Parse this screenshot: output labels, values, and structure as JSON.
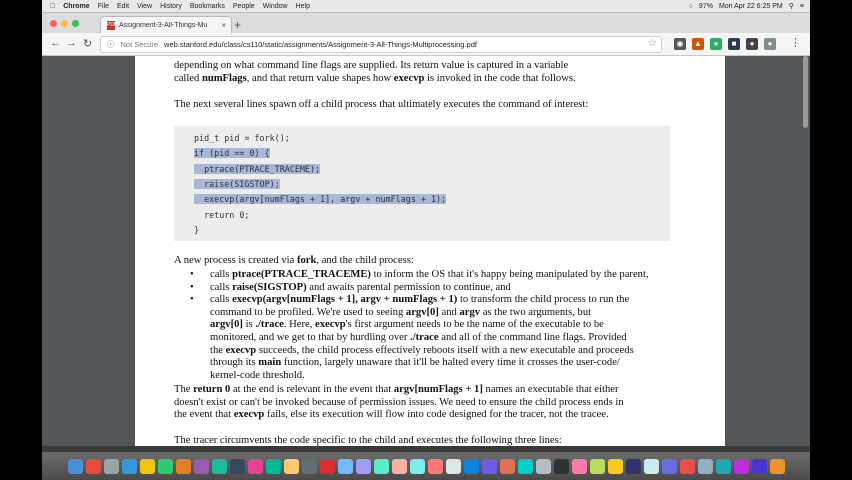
{
  "menubar": {
    "items": [
      "Chrome",
      "File",
      "Edit",
      "View",
      "History",
      "Bookmarks",
      "People",
      "Window",
      "Help"
    ],
    "battery": "97%",
    "datetime": "Mon Apr 22  6:25 PM"
  },
  "tab": {
    "title": "Assignment-3-All-Things-Mu",
    "favicon": "PDF"
  },
  "toolbar": {
    "security": "Not Secure",
    "url": "web.stanford.edu/class/cs110/static/assignments/Assignment-3-All-Things-Multiprocessing.pdf"
  },
  "doc": {
    "p1": [
      [
        {
          "t": "depending on what command line flags are supplied.  Its return value is captured in a variable"
        }
      ],
      [
        {
          "t": "called "
        },
        {
          "t": "numFlags",
          "b": true
        },
        {
          "t": ", and that return value shapes how "
        },
        {
          "t": "execvp",
          "b": true
        },
        {
          "t": " is invoked in the code that follows."
        }
      ]
    ],
    "p2": "The next several lines spawn off a child process that ultimately executes the command of interest:",
    "code": [
      "pid_t pid = fork();",
      "if (pid == 0) {",
      "  ptrace(PTRACE_TRACEME);",
      "  raise(SIGSTOP);",
      "  execvp(argv[numFlags + 1], argv + numFlags + 1);",
      "  return 0;",
      "}"
    ],
    "p3": [
      {
        "t": "A new process is created via "
      },
      {
        "t": "fork",
        "b": true
      },
      {
        "t": ", and the child process:"
      }
    ],
    "bullets": [
      [
        [
          {
            "t": "calls "
          },
          {
            "t": "ptrace(PTRACE_TRACEME)",
            "b": true
          },
          {
            "t": " to inform the OS that it's happy being manipulated by the parent,"
          }
        ]
      ],
      [
        [
          {
            "t": "calls "
          },
          {
            "t": "raise(SIGSTOP)",
            "b": true
          },
          {
            "t": " and awaits parental permission to continue, and"
          }
        ]
      ],
      [
        [
          {
            "t": "calls "
          },
          {
            "t": "execvp(argv[numFlags + 1], argv + numFlags + 1)",
            "b": true
          },
          {
            "t": " to transform the child process to run the"
          }
        ],
        [
          {
            "t": "command to be profiled.  We're used to seeing "
          },
          {
            "t": "argv[0]",
            "b": true
          },
          {
            "t": " and "
          },
          {
            "t": "argv",
            "b": true
          },
          {
            "t": " as the two arguments, but"
          }
        ],
        [
          {
            "t": "argv[0]",
            "b": true
          },
          {
            "t": " is "
          },
          {
            "t": "./trace",
            "b": true
          },
          {
            "t": ".  Here, "
          },
          {
            "t": "execvp",
            "b": true
          },
          {
            "t": "'s first argument needs to be the name of the executable to be"
          }
        ],
        [
          {
            "t": "monitored, and we get to that by hurdling over  "
          },
          {
            "t": "./trace",
            "b": true
          },
          {
            "t": " and all of the command line flags.  Provided"
          }
        ],
        [
          {
            "t": "the "
          },
          {
            "t": "execvp",
            "b": true
          },
          {
            "t": " succeeds, the child process effectively reboots itself with a new executable and proceeds"
          }
        ],
        [
          {
            "t": "through its "
          },
          {
            "t": "main",
            "b": true
          },
          {
            "t": " function, largely unaware that it'll be halted every time it crosses the user-code/"
          }
        ],
        [
          {
            "t": "kernel-code threshold."
          }
        ]
      ]
    ],
    "p4": [
      [
        {
          "t": "The "
        },
        {
          "t": "return 0",
          "b": true
        },
        {
          "t": " at the end is relevant in the event that "
        },
        {
          "t": "argv[numFlags + 1]",
          "b": true
        },
        {
          "t": " names an executable that either"
        }
      ],
      [
        {
          "t": "doesn't exist or can't be invoked because of permission issues.  We need to ensure the child process ends in"
        }
      ],
      [
        {
          "t": "the event that "
        },
        {
          "t": "execvp",
          "b": true
        },
        {
          "t": " fails, else its execution will flow into code designed for the tracer, not the tracee."
        }
      ]
    ],
    "p5": "The tracer circumvents the code specific to the child and executes the following three lines:"
  },
  "colors": {
    "selection": "#a8b7d6",
    "code_bg": "#ededed",
    "viewer_bg": "#525659"
  },
  "dock_icons": [
    "#4a90d9",
    "#e74c3c",
    "#95a5a6",
    "#3498db",
    "#f1c40f",
    "#2ecc71",
    "#e67e22",
    "#9b59b6",
    "#1abc9c",
    "#34495e",
    "#e84393",
    "#00b894",
    "#fdcb6e",
    "#636e72",
    "#d63031",
    "#74b9ff",
    "#a29bfe",
    "#55efc4",
    "#fab1a0",
    "#81ecec",
    "#ff7675",
    "#dfe6e9",
    "#0984e3",
    "#6c5ce7",
    "#e17055",
    "#00cec9",
    "#b2bec3",
    "#2d3436",
    "#fd79a8",
    "#badc58",
    "#f9ca24",
    "#30336b",
    "#c7ecee",
    "#686de0",
    "#eb4d4b",
    "#95afc0",
    "#22a6b3",
    "#be2edd",
    "#4834d4",
    "#f0932b"
  ]
}
